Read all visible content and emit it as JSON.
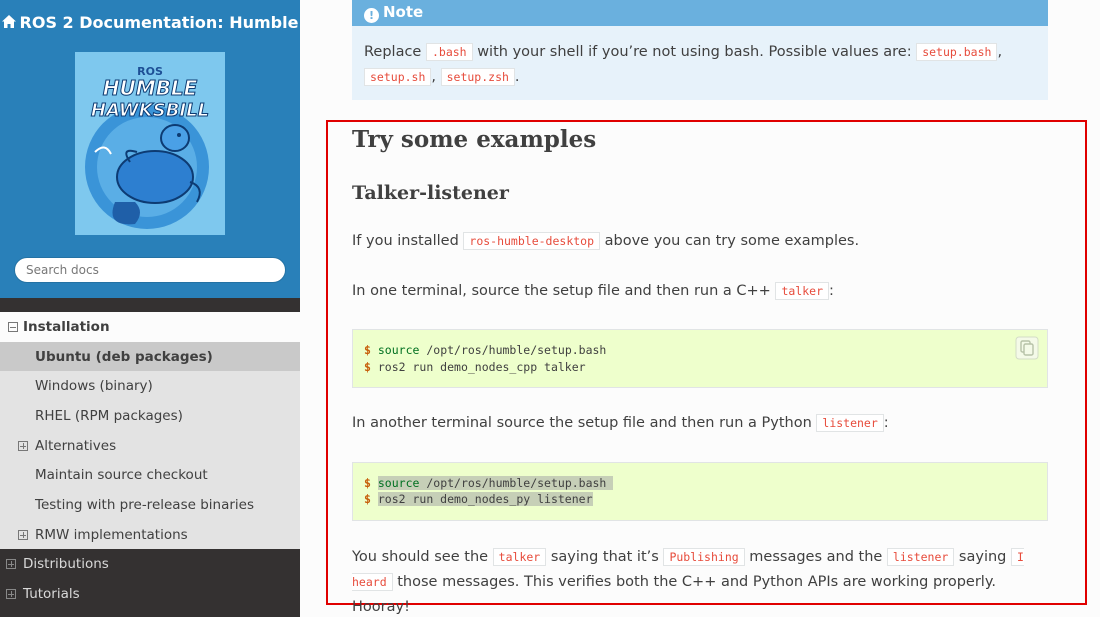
{
  "sidebar": {
    "project_title": "ROS 2 Documentation: Humble",
    "logo": {
      "brand": "ROS",
      "line1": "HUMBLE",
      "line2": "HAWKSBILL"
    },
    "search_placeholder": "Search docs",
    "nav": [
      {
        "label": "Installation",
        "level": 1,
        "expanded": true
      },
      {
        "label": "Ubuntu (deb packages)",
        "level": 2,
        "current": true
      },
      {
        "label": "Windows (binary)",
        "level": 2
      },
      {
        "label": "RHEL (RPM packages)",
        "level": 2
      },
      {
        "label": "Alternatives",
        "level": 2,
        "expandable": true
      },
      {
        "label": "Maintain source checkout",
        "level": 2
      },
      {
        "label": "Testing with pre-release binaries",
        "level": 2
      },
      {
        "label": "RMW implementations",
        "level": 2,
        "expandable": true
      },
      {
        "label": "Distributions",
        "level": 1,
        "expandable": true
      },
      {
        "label": "Tutorials",
        "level": 1,
        "expandable": true
      }
    ]
  },
  "note": {
    "title": "Note",
    "text1": "Replace",
    "code_bash": ".bash",
    "text2": "with your shell if you’re not using bash. Possible values are:",
    "code_setup_bash": "setup.bash",
    "comma1": ",",
    "code_setup_sh": "setup.sh",
    "comma2": ",",
    "code_setup_zsh": "setup.zsh",
    "period": "."
  },
  "section": {
    "heading": "Try some examples",
    "subheading": "Talker-listener",
    "p1_before": "If you installed",
    "p1_code": "ros-humble-desktop",
    "p1_after": "above you can try some examples.",
    "p2_before": "In one terminal, source the setup file and then run a C++",
    "p2_code": "talker",
    "p2_after": ":",
    "code1": {
      "line1_prompt": "$",
      "line1_cmd": "source",
      "line1_rest": " /opt/ros/humble/setup.bash",
      "line2_prompt": "$",
      "line2_rest": "ros2 run demo_nodes_cpp talker"
    },
    "p3_before": "In another terminal source the setup file and then run a Python",
    "p3_code": "listener",
    "p3_after": ":",
    "code2": {
      "line1_prompt": "$",
      "line1_cmd": "source",
      "line1_rest": " /opt/ros/humble/setup.bash",
      "line2_prompt": "$",
      "line2_rest": "ros2 run demo_nodes_py listener"
    },
    "p4_t1": "You should see the",
    "p4_c1": "talker",
    "p4_t2": "saying that it’s",
    "p4_c2": "Publishing",
    "p4_t3": "messages and the",
    "p4_c3": "listener",
    "p4_t4": "saying",
    "p4_c4": "I heard",
    "p4_t5": "those messages. This verifies both the C++ and Python APIs are working properly. Hooray!"
  },
  "colors": {
    "sidebar_top": "#2980b9",
    "sidebar_dark": "#343131",
    "note_header": "#6ab0de",
    "note_bg": "#e7f2fa",
    "code_bg": "#eeffcc",
    "highlight_frame": "#e00000",
    "literal": "#e74c3c"
  },
  "icons": [
    "home-icon",
    "info-icon",
    "copy-icon",
    "collapse-icon",
    "expand-icon"
  ]
}
